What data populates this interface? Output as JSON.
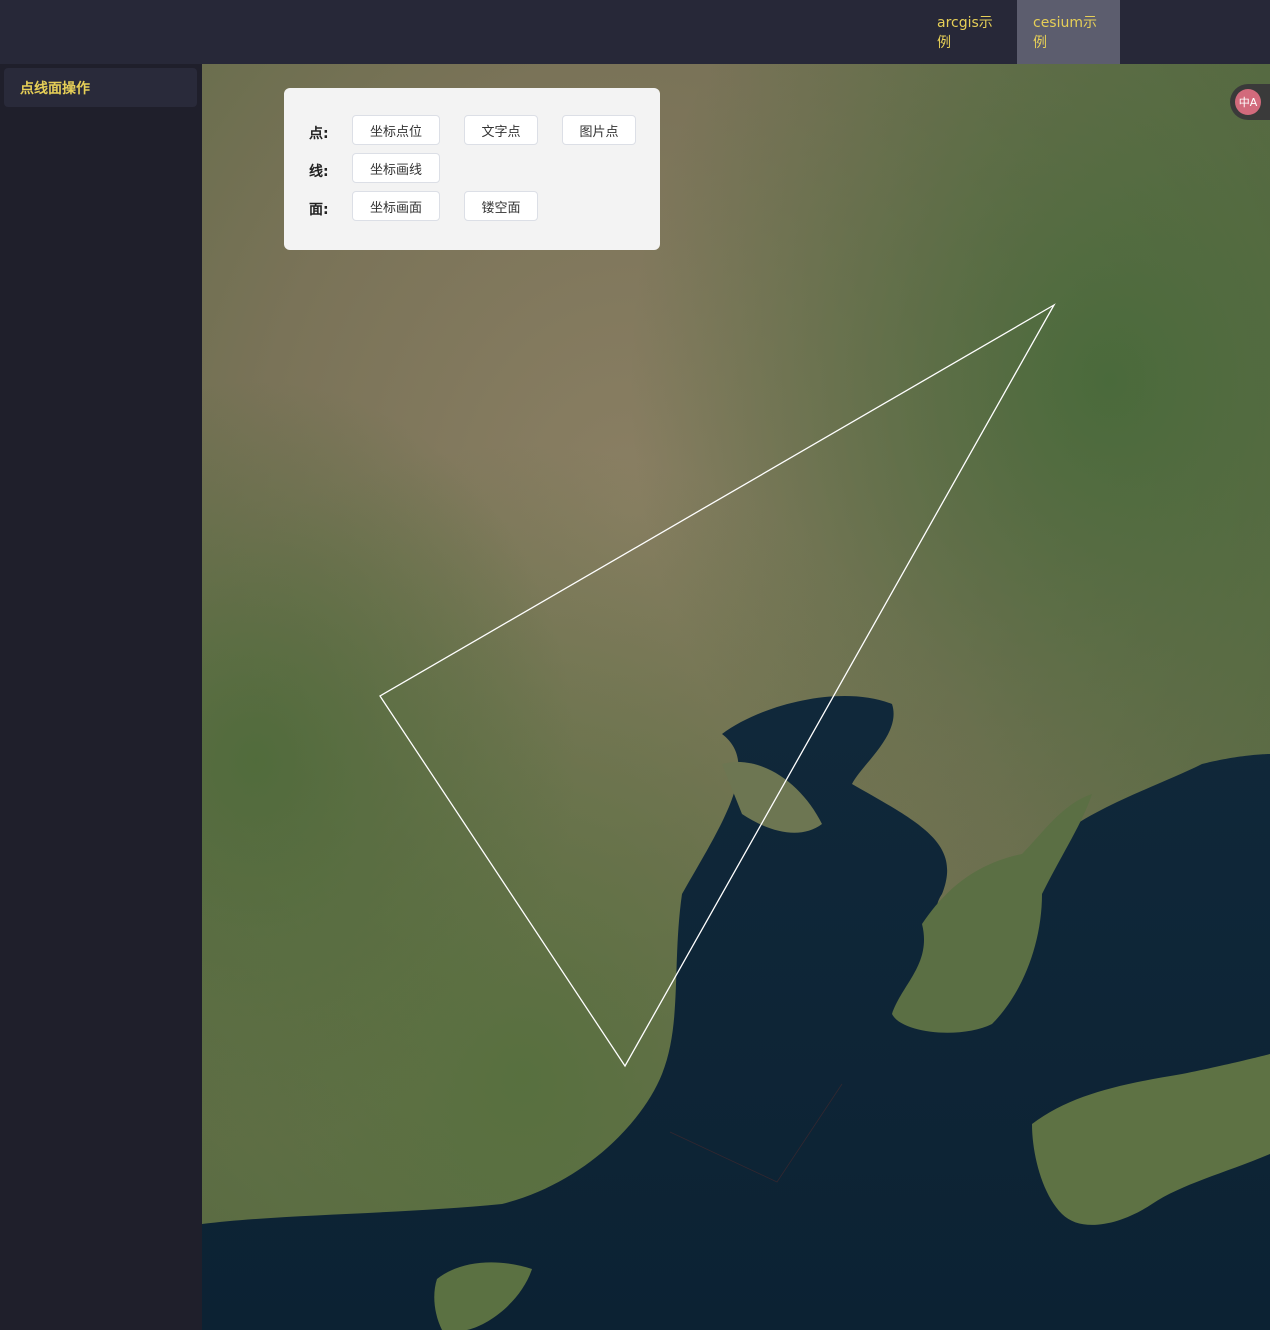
{
  "header": {
    "tabs": [
      {
        "label": "arcgis示例",
        "active": false
      },
      {
        "label": "cesium示例",
        "active": true
      }
    ]
  },
  "sidebar": {
    "items": [
      {
        "label": "点线面操作"
      }
    ]
  },
  "panel": {
    "rows": [
      {
        "label": "点:",
        "buttons": [
          "坐标点位",
          "文字点",
          "图片点"
        ]
      },
      {
        "label": "线:",
        "buttons": [
          "坐标画线"
        ]
      },
      {
        "label": "面:",
        "buttons": [
          "坐标画面",
          "镂空面"
        ]
      }
    ]
  },
  "translate_widget": {
    "icon": "translate-icon",
    "glyph": "中A"
  },
  "colors": {
    "accent": "#e6cf57",
    "header_bg": "#272838",
    "sidebar_bg": "#1f1f2b",
    "active_tab_bg": "#5c5d6e",
    "drawn_polygon_stroke": "#ffffff"
  }
}
